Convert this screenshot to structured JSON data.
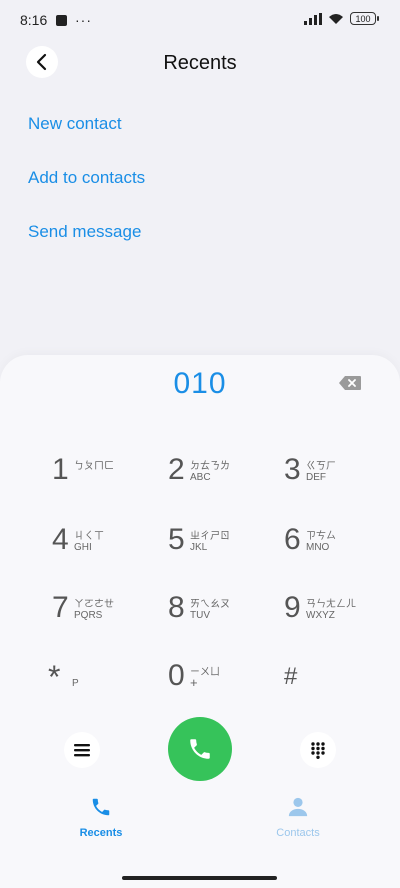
{
  "status": {
    "time": "8:16",
    "dots": "···",
    "battery": "100"
  },
  "header": {
    "title": "Recents"
  },
  "actions": [
    "New contact",
    "Add to contacts",
    "Send message"
  ],
  "dialer": {
    "number": "010"
  },
  "keys": [
    {
      "digit": "1",
      "zhuyin": "ㄅㄆㄇㄈ",
      "letters": ""
    },
    {
      "digit": "2",
      "zhuyin": "ㄉㄊㄋㄌ",
      "letters": "ABC"
    },
    {
      "digit": "3",
      "zhuyin": "ㄍㄎㄏ",
      "letters": "DEF"
    },
    {
      "digit": "4",
      "zhuyin": "ㄐㄑㄒ",
      "letters": "GHI"
    },
    {
      "digit": "5",
      "zhuyin": "ㄓㄔㄕㄖ",
      "letters": "JKL"
    },
    {
      "digit": "6",
      "zhuyin": "ㄗㄘㄙ",
      "letters": "MNO"
    },
    {
      "digit": "7",
      "zhuyin": "ㄚㄛㄜㄝ",
      "letters": "PQRS"
    },
    {
      "digit": "8",
      "zhuyin": "ㄞㄟㄠㄡ",
      "letters": "TUV"
    },
    {
      "digit": "9",
      "zhuyin": "ㄢㄣㄤㄥㄦ",
      "letters": "WXYZ"
    },
    {
      "digit": "*",
      "zhuyin": "",
      "letters": "P"
    },
    {
      "digit": "0",
      "zhuyin": "ㄧㄨㄩ",
      "letters": "+"
    },
    {
      "digit": "#",
      "zhuyin": "",
      "letters": ""
    }
  ],
  "tabs": {
    "recents": "Recents",
    "contacts": "Contacts"
  },
  "colors": {
    "accent": "#1a8ee6",
    "call": "#36c35a",
    "background": "#f1f1f6"
  }
}
